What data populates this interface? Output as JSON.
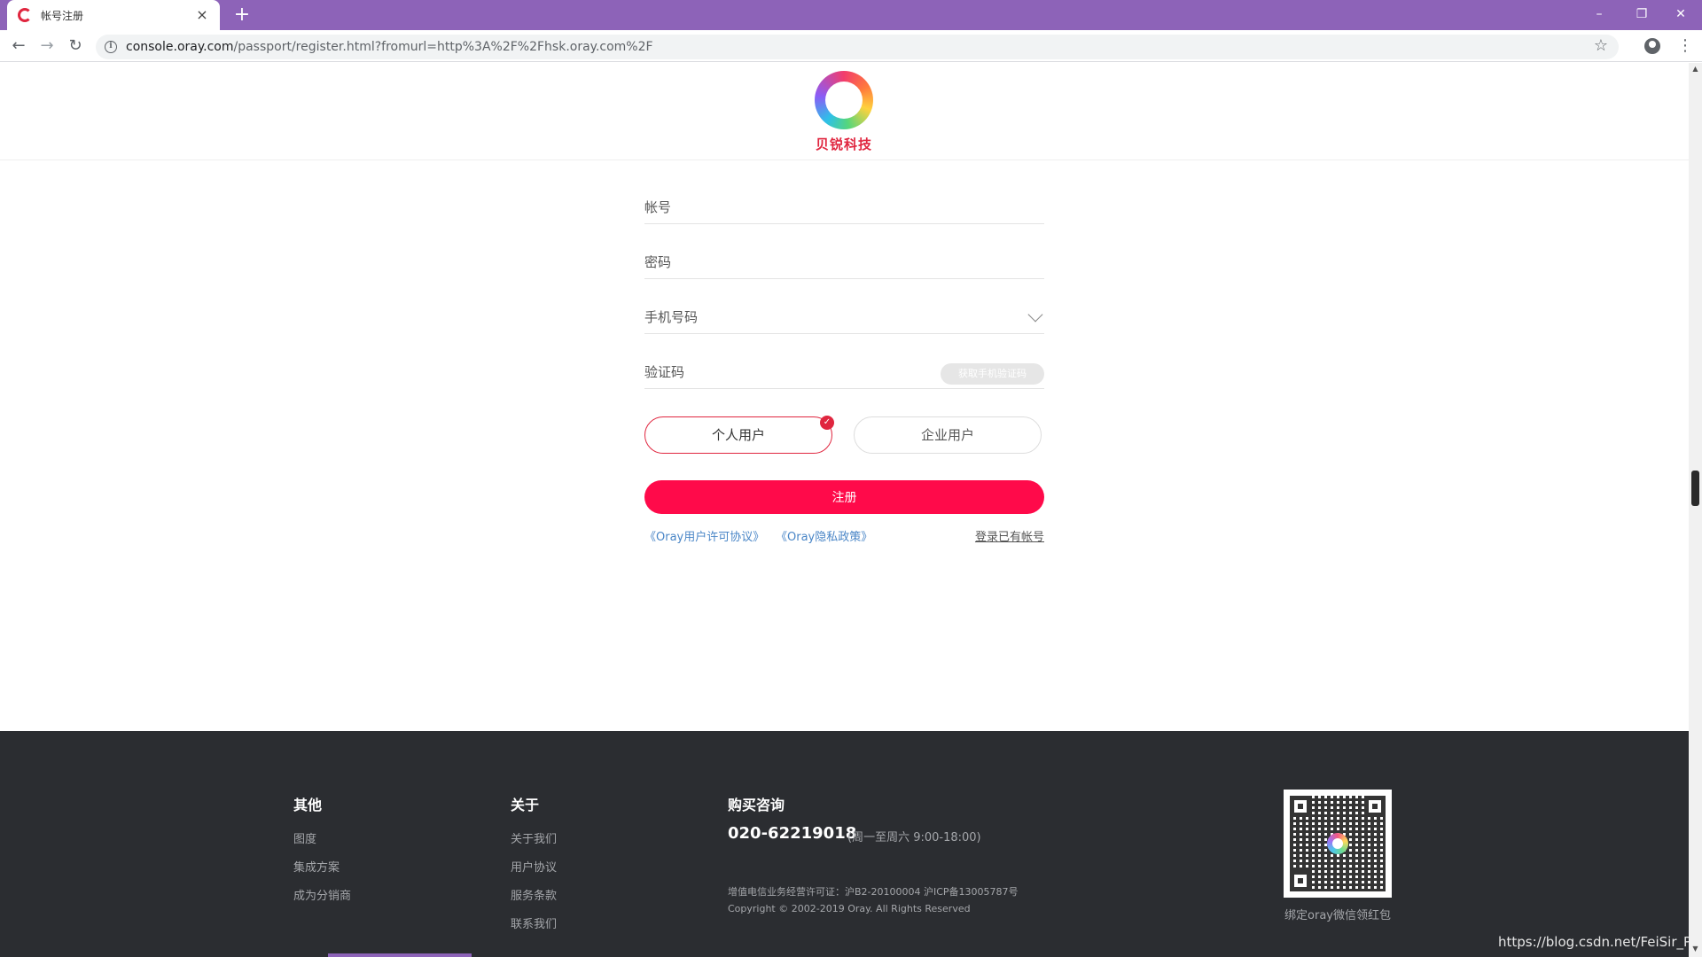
{
  "browser": {
    "tab_title": "帐号注册",
    "url_host": "console.oray.com",
    "url_path": "/passport/register.html?fromurl=http%3A%2F%2Fhsk.oray.com%2F",
    "icons": [
      "favicon",
      "close-icon",
      "plus-icon",
      "minimize-icon",
      "restore-icon",
      "window-close-icon",
      "back-arrow-icon",
      "forward-arrow-icon",
      "reload-icon",
      "info-icon",
      "star-icon",
      "account-icon",
      "kebab-menu-icon"
    ]
  },
  "header": {
    "logo_text": "贝锐科技"
  },
  "form": {
    "account_placeholder": "帐号",
    "password_placeholder": "密码",
    "phone_placeholder": "手机号码",
    "code_placeholder": "验证码",
    "get_code_label": "获取手机验证码",
    "personal_user_label": "个人用户",
    "enterprise_user_label": "企业用户",
    "submit_label": "注册",
    "agreement_link": "《Oray用户许可协议》",
    "privacy_link": "《Oray隐私政策》",
    "login_link": "登录已有帐号"
  },
  "footer": {
    "other": {
      "title": "其他",
      "items": [
        "图度",
        "集成方案",
        "成为分销商"
      ]
    },
    "about": {
      "title": "关于",
      "items": [
        "关于我们",
        "用户协议",
        "服务条款",
        "联系我们"
      ]
    },
    "purchase": {
      "title": "购买咨询",
      "phone": "020-62219018",
      "hours": "(周一至周六 9:00-18:00)",
      "license": "增值电信业务经营许可证：沪B2-20100004 沪ICP备13005787号",
      "copyright": "Copyright © 2002-2019 Oray. All Rights Reserved"
    },
    "qr_caption": "绑定oray微信领红包",
    "watermark": "https://blog.csdn.net/FeiSir_PC"
  },
  "colors": {
    "accent": "#ff0a4a",
    "brand": "#e0263f",
    "chrome": "#8d63b8",
    "footer_bg": "#2b2d31",
    "link": "#4a86c7"
  }
}
